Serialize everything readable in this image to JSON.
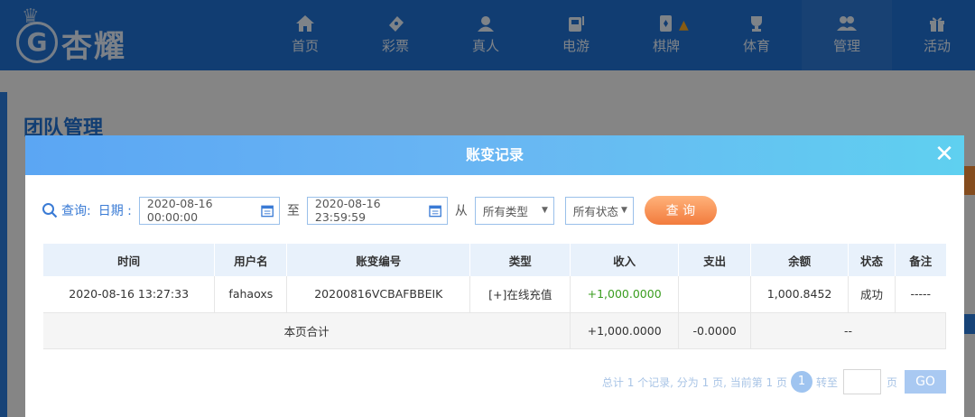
{
  "header": {
    "brand": "杏耀",
    "nav": [
      {
        "label": "首页",
        "icon": "home-icon"
      },
      {
        "label": "彩票",
        "icon": "ticket-icon"
      },
      {
        "label": "真人",
        "icon": "live-dealer-icon"
      },
      {
        "label": "电游",
        "icon": "slot-machine-icon"
      },
      {
        "label": "棋牌",
        "icon": "cards-icon"
      },
      {
        "label": "体育",
        "icon": "trophy-icon"
      },
      {
        "label": "管理",
        "icon": "users-icon"
      },
      {
        "label": "活动",
        "icon": "gift-icon"
      }
    ]
  },
  "page": {
    "title": "团队管理"
  },
  "modal": {
    "title": "账变记录",
    "filters": {
      "query_label": "查询:",
      "date_label": "日期 :",
      "start_date": "2020-08-16 00:00:00",
      "to_label": "至",
      "end_date": "2020-08-16 23:59:59",
      "from_label": "从",
      "type_select": "所有类型",
      "status_select": "所有状态",
      "query_button": "查 询"
    },
    "table": {
      "headers": [
        "时间",
        "用户名",
        "账变编号",
        "类型",
        "收入",
        "支出",
        "余额",
        "状态",
        "备注"
      ],
      "rows": [
        [
          "2020-08-16 13:27:33",
          "fahaoxs",
          "20200816VCBAFBBEIK",
          "[+]在线充值",
          "+1,000.0000",
          "",
          "1,000.8452",
          "成功",
          "-----"
        ]
      ],
      "summary": {
        "label": "本页合计",
        "income": "+1,000.0000",
        "expense": "-0.0000",
        "balance": "--"
      }
    },
    "pager": {
      "info": "总计 1 个记录, 分为 1 页, 当前第 1 页",
      "current_page": "1",
      "goto_label": "转至",
      "page_unit": "页",
      "go_button": "GO"
    }
  },
  "colors": {
    "accent": "#1f6fd0",
    "income": "#3a9d1f",
    "button_orange": "#f27b3d"
  }
}
